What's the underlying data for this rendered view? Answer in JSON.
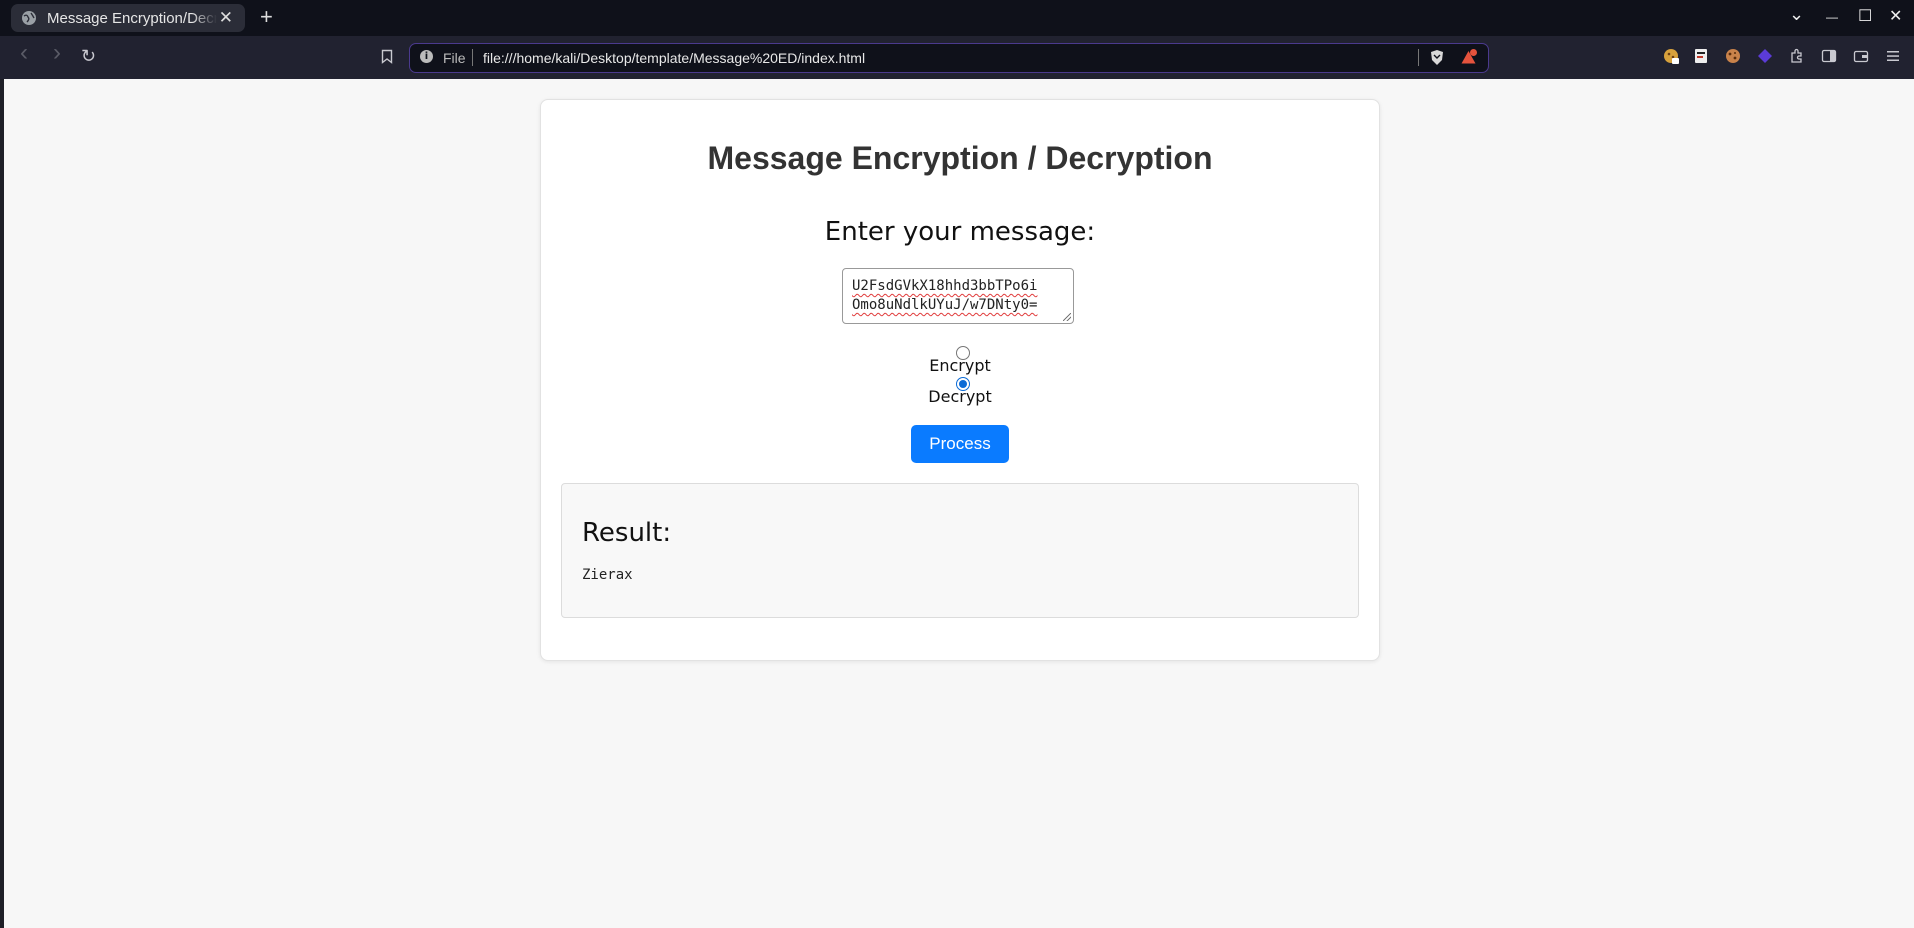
{
  "browser": {
    "tab_title": "Message Encryption/Decryption",
    "new_tab": "+",
    "close_tab": "✕",
    "address_scheme": "File",
    "url": "file:///home/kali/Desktop/template/Message%20ED/index.html",
    "info_glyph": "i",
    "nav_back": "‹",
    "nav_forward": "›",
    "reload": "↻",
    "minimize": "—",
    "maximize": "☐",
    "close_window": "✕",
    "dropdown": "⌄"
  },
  "page": {
    "title": "Message Encryption / Decryption",
    "prompt_label": "Enter your message:",
    "message_line1": "U2FsdGVkX18hhd3bbTPo6i",
    "message_line2": "Omo8uNdlkUYuJ/w7DNty0=",
    "mode_options": [
      {
        "label": "Encrypt",
        "selected": false
      },
      {
        "label": "Decrypt",
        "selected": true
      }
    ],
    "process_label": "Process",
    "result_heading": "Result:",
    "result_value": "Zierax"
  },
  "colors": {
    "accent": "#0a7bff",
    "tab_bar": "#0f111a",
    "toolbar": "#212230",
    "page_bg": "#f7f7f7"
  }
}
